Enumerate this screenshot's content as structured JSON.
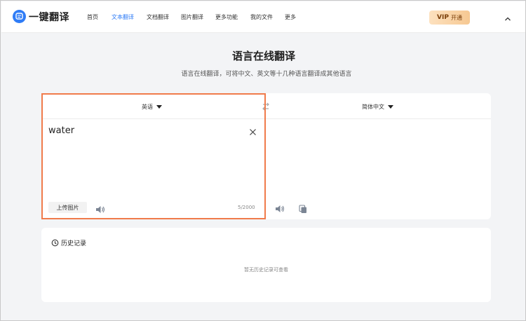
{
  "header": {
    "brand": "一键翻译",
    "nav": [
      {
        "label": "首页",
        "active": false
      },
      {
        "label": "文本翻译",
        "active": true
      },
      {
        "label": "文档翻译",
        "active": false
      },
      {
        "label": "图片翻译",
        "active": false
      },
      {
        "label": "更多功能",
        "active": false
      },
      {
        "label": "我的文件",
        "active": false
      },
      {
        "label": "更多",
        "active": false
      }
    ],
    "vip_label": "VIP",
    "vip_action": "开通"
  },
  "main": {
    "title": "语言在线翻译",
    "subtitle": "语言在线翻译，可将中文、英文等十几种语言翻译成其他语言"
  },
  "translator": {
    "source_language": "英语",
    "target_language": "简体中文",
    "source_text": "water",
    "upload_label": "上传图片",
    "char_count": "5/2000"
  },
  "history": {
    "title": "历史记录",
    "empty_text": "暂无历史记录可查看"
  },
  "colors": {
    "accent": "#2f7cf6",
    "highlight_border": "#f07b4b",
    "vip_gradient_start": "#fde1bf",
    "vip_gradient_end": "#f6c892"
  }
}
